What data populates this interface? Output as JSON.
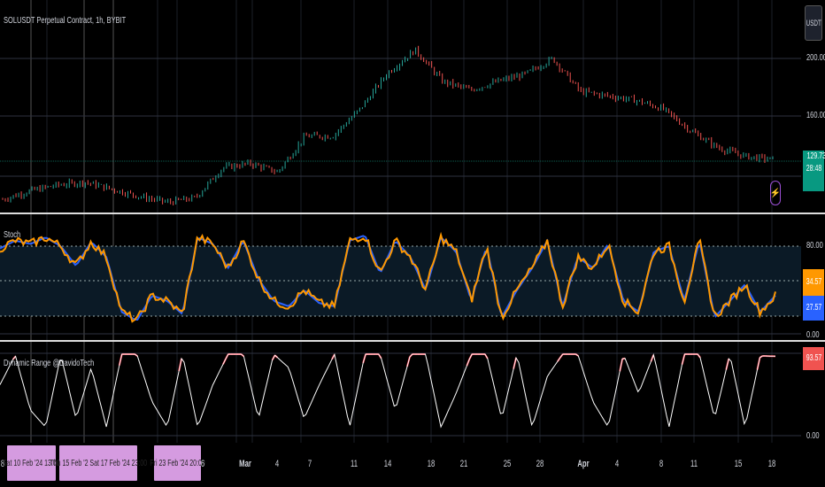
{
  "header": {
    "symbol_title": "SOLUSDT Perpetual Contract, 1h, BYBIT",
    "currency": "USDT"
  },
  "price_axis": {
    "labels": [
      "200.00",
      "160.00"
    ],
    "last_price": "129.73",
    "countdown": "28:48",
    "last_price_color": "#089981"
  },
  "stoch_pane": {
    "title": "Stoch",
    "levels": [
      "80.00",
      "0.00"
    ],
    "k_value": "34.57",
    "d_value": "27.57",
    "k_color": "#ff9800",
    "d_color": "#2962ff"
  },
  "range_pane": {
    "title": "Dynamic Range @DavidoTech",
    "levels": [
      "0.00"
    ],
    "value": "93.57",
    "value_color": "#f23645"
  },
  "time_axis": {
    "left_edge": "8",
    "highlighted_dates": [
      "Sat 10 Feb '24   13:00",
      "Thu 15 Feb '2  Sat 17 Feb '24   23:00",
      "Fri 23 Feb '24   20:00"
    ],
    "partial_label": "6",
    "ticks": [
      "Mar",
      "4",
      "7",
      "11",
      "14",
      "18",
      "21",
      "25",
      "28",
      "Apr",
      "4",
      "8",
      "11",
      "15",
      "18"
    ]
  },
  "chart_data": {
    "type": "line",
    "price_series": [
      102,
      108,
      112,
      114,
      109,
      104,
      100,
      103,
      124,
      127,
      121,
      146,
      146,
      165,
      190,
      206,
      184,
      178,
      184,
      189,
      200,
      177,
      174,
      171,
      165,
      150,
      138,
      132,
      129.73
    ],
    "stoch_series": [
      78,
      85,
      82,
      88,
      80,
      62,
      84,
      70,
      20,
      12,
      35,
      30,
      18,
      88,
      82,
      60,
      85,
      50,
      30,
      25,
      40,
      28,
      25,
      85,
      90,
      55,
      85,
      70,
      40,
      88,
      75,
      30,
      80,
      15,
      40,
      60,
      85,
      25,
      70,
      60,
      82,
      30,
      20,
      75,
      80,
      30,
      85,
      15,
      30,
      45,
      20,
      35
    ],
    "range_series": [
      60,
      95,
      30,
      10,
      95,
      20,
      80,
      10,
      96,
      96,
      40,
      10,
      96,
      10,
      60,
      96,
      96,
      20,
      96,
      80,
      20,
      60,
      96,
      10,
      96,
      96,
      30,
      96,
      96,
      10,
      50,
      96,
      96,
      20,
      96,
      10,
      70,
      96,
      96,
      40,
      10,
      96,
      50,
      96,
      10,
      96,
      96,
      20,
      96,
      10,
      94,
      93.57
    ]
  },
  "colors": {
    "bg": "#000000",
    "grid": "#2a2e39",
    "candle_up": "#26a69a",
    "candle_down": "#ef5350",
    "stoch_band": "#0b1a26",
    "range_line": "#ffffff",
    "range_high": "#f23645",
    "date_box": "#d59be0"
  }
}
